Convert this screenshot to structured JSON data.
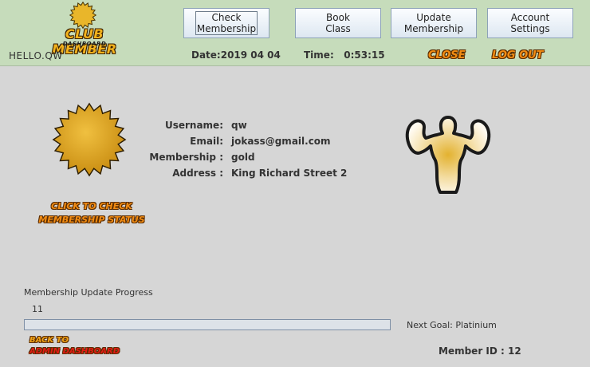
{
  "header": {
    "logo_title": "CLUB MEMBER",
    "logo_subtitle": "DASHBOARD",
    "greeting": "HELLO.QW",
    "nav": [
      {
        "label": "Check\nMembership"
      },
      {
        "label": "Book\nClass"
      },
      {
        "label": "Update\nMembership"
      },
      {
        "label": "Account\nSettings"
      }
    ],
    "date": "Date:2019 04 04",
    "time": "Time:   0:53:15",
    "close_label": "CLOSE",
    "logout_label": "LOG OUT"
  },
  "main": {
    "check_status_line1": "CLICK TO CHECK",
    "check_status_line2": "MEMBERSHIP STATUS",
    "info": {
      "username_label": "Username:",
      "username": "qw",
      "email_label": "Email:",
      "email": "jokass@gmail.com",
      "membership_label": "Membership :",
      "membership": "gold",
      "address_label": "Address :",
      "address": "King Richard Street 2"
    }
  },
  "progress": {
    "label": "Membership Update Progress",
    "value_text": "11",
    "fraction": 0,
    "next_goal": "Next Goal: Platinium"
  },
  "footer": {
    "back_line1": "BACK TO",
    "back_line2": "ADMIN DASHBOARD",
    "member_id": "Member ID : 12"
  },
  "colors": {
    "header_bg": "#c6dcbb",
    "body_bg": "#d6d6d6",
    "gold": "#e0a82e",
    "comic_orange": "#f28c13",
    "back_red": "#e41b14"
  }
}
